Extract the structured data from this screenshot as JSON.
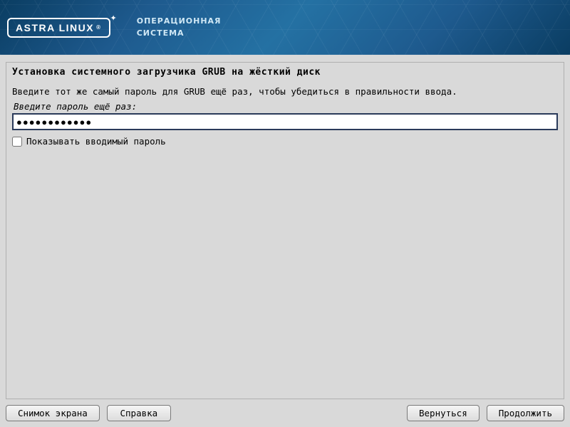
{
  "header": {
    "logo_text": "ASTRA LINUX",
    "registered": "®",
    "os_line1": "ОПЕРАЦИОННАЯ",
    "os_line2": "СИСТЕМА"
  },
  "main": {
    "title": "Установка системного загрузчика GRUB на жёсткий диск",
    "instruction": "Введите тот же самый пароль для GRUB ещё раз, чтобы убедиться в правильности ввода.",
    "field_label": "Введите пароль ещё раз:",
    "password_value": "●●●●●●●●●●●●",
    "show_password_label": "Показывать вводимый пароль"
  },
  "buttons": {
    "screenshot": "Снимок экрана",
    "help": "Справка",
    "back": "Вернуться",
    "continue": "Продолжить"
  }
}
